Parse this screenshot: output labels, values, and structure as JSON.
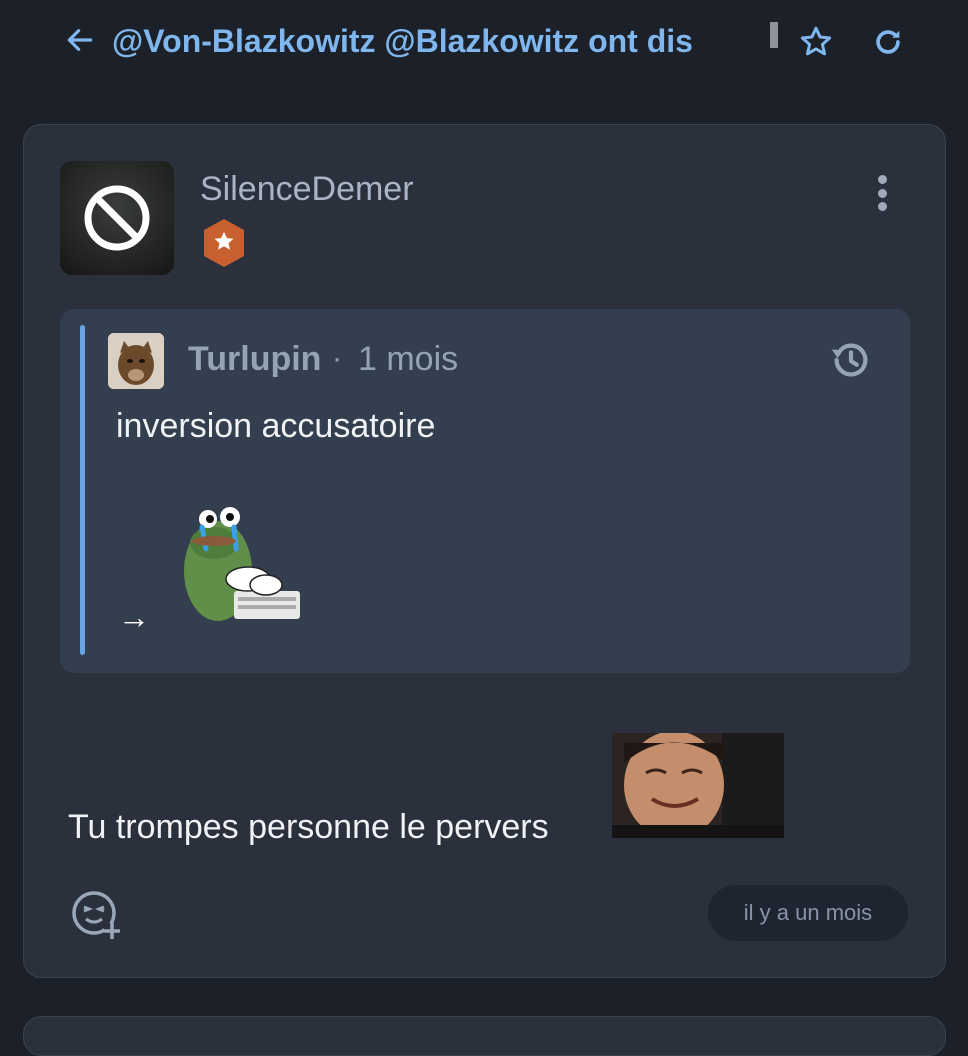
{
  "header": {
    "back_icon": "arrow-left-icon",
    "title": "@Von-Blazkowitz @Blazkowitz ont dis",
    "star_icon": "star-outline-icon",
    "refresh_icon": "refresh-icon"
  },
  "post": {
    "avatar_icon": "block-icon",
    "username": "SilenceDemer",
    "badge_icon": "star-hexagon-badge-icon",
    "menu_icon": "more-vertical-icon",
    "quote": {
      "author": "Turlupin",
      "separator": "·",
      "time": "1 mois",
      "history_icon": "history-icon",
      "text": "inversion accusatoire",
      "arrow": "→",
      "sticker": "crying-pepe-typing-sticker"
    },
    "text": "Tu trompes personne le pervers",
    "image": "laughing-man-photo",
    "react_icon": "add-reaction-icon",
    "date": "il y a un mois"
  },
  "colors": {
    "background": "#1c2028",
    "card": "#2a313d",
    "quote_bg": "#333e4e",
    "accent": "#7fb6ee",
    "badge": "#c8612f"
  }
}
